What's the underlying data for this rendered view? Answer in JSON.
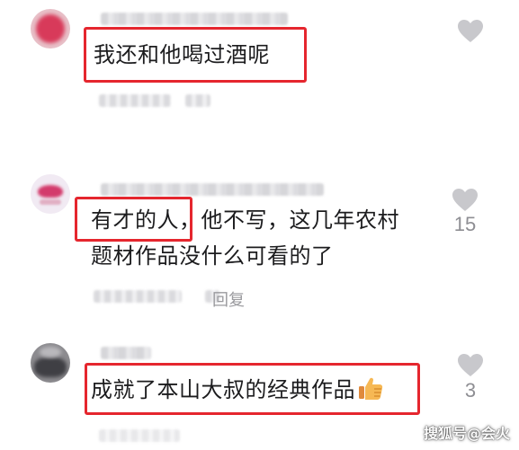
{
  "comments": [
    {
      "text_lines": [
        "我还和他喝过酒呢"
      ],
      "highlight": "我还和他喝过酒呢",
      "reply_label": "",
      "likes": "",
      "colors": {
        "avatar": "#d83a5a"
      }
    },
    {
      "text_lines": [
        "有才的人，他不写，这几年农村",
        "题材作品没什么可看的了"
      ],
      "highlight": "有才的人",
      "reply_label": "回复",
      "likes": "15",
      "colors": {
        "avatar": "#e9e0ee"
      }
    },
    {
      "text_lines": [
        "成就了本山大叔的经典作品"
      ],
      "highlight": "成就了本山大叔的经典作品",
      "reply_label": "",
      "likes": "3",
      "colors": {
        "avatar": "#6f6e72"
      }
    }
  ],
  "icons": {
    "like": "heart-icon",
    "thumbs_up": "thumbs-up-emoji"
  },
  "watermark": "搜狐号@会火",
  "colors": {
    "highlight_border": "#e5262e",
    "text": "#1c1c1e",
    "meta": "#9a9a9e",
    "heart": "#c8c8cc"
  }
}
